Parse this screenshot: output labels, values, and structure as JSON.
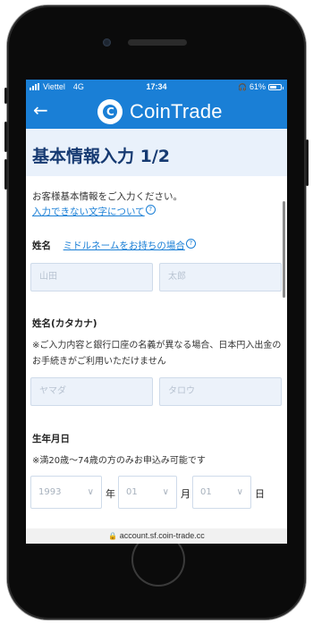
{
  "status": {
    "carrier": "Viettel",
    "network": "4G",
    "time": "17:34",
    "battery": "61%",
    "battery_level": 0.61
  },
  "nav": {
    "back_icon": "arrow-left-icon",
    "brand": "CoinTrade"
  },
  "page": {
    "title": "基本情報入力 1/2",
    "intro_text": "お客様基本情報をご入力ください。",
    "intro_link": "入力できない文字について",
    "help_glyph": "?"
  },
  "form": {
    "name_label": "姓名",
    "middle_name_link": "ミドルネームをお持ちの場合",
    "last_name_placeholder": "山田",
    "first_name_placeholder": "太郎",
    "kana_label": "姓名(カタカナ)",
    "kana_note": "※ご入力内容と銀行口座の名義が異なる場合、日本円入出金のお手続きがご利用いただけません",
    "last_kana_placeholder": "ヤマダ",
    "first_kana_placeholder": "タロウ",
    "dob_label": "生年月日",
    "dob_note": "※満20歳〜74歳の方のみお申込み可能です",
    "year_value": "1993",
    "year_unit": "年",
    "month_value": "01",
    "month_unit": "月",
    "day_value": "01",
    "day_unit": "日"
  },
  "browser": {
    "url": "account.sf.coin-trade.cc"
  },
  "colors": {
    "brand_blue": "#1a7fd6",
    "title_bg": "#e9f1fb",
    "title_text": "#163a72"
  }
}
